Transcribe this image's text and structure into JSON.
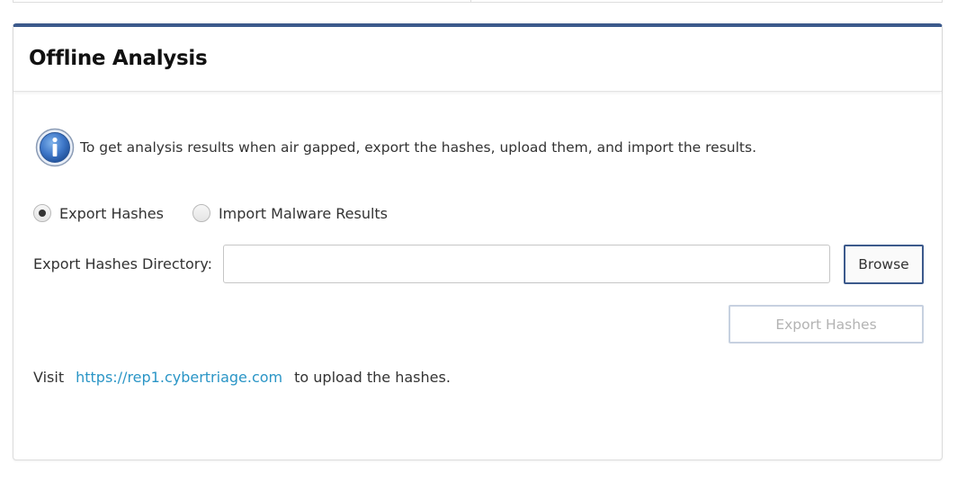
{
  "panel": {
    "title": "Offline Analysis",
    "accent_color": "#3c5a8c"
  },
  "info": {
    "icon": "info-icon",
    "text": "To get analysis results when air gapped, export the hashes, upload them, and import the results."
  },
  "mode": {
    "options": [
      {
        "label": "Export Hashes",
        "selected": true
      },
      {
        "label": "Import Malware Results",
        "selected": false
      }
    ]
  },
  "export_dir": {
    "label": "Export Hashes Directory:",
    "value": "",
    "placeholder": ""
  },
  "buttons": {
    "browse_label": "Browse",
    "export_label": "Export Hashes",
    "export_enabled": false
  },
  "upload": {
    "prefix": "Visit",
    "link_text": "https://rep1.cybertriage.com",
    "suffix": "to upload the hashes.",
    "link_color": "#2a95c6"
  }
}
